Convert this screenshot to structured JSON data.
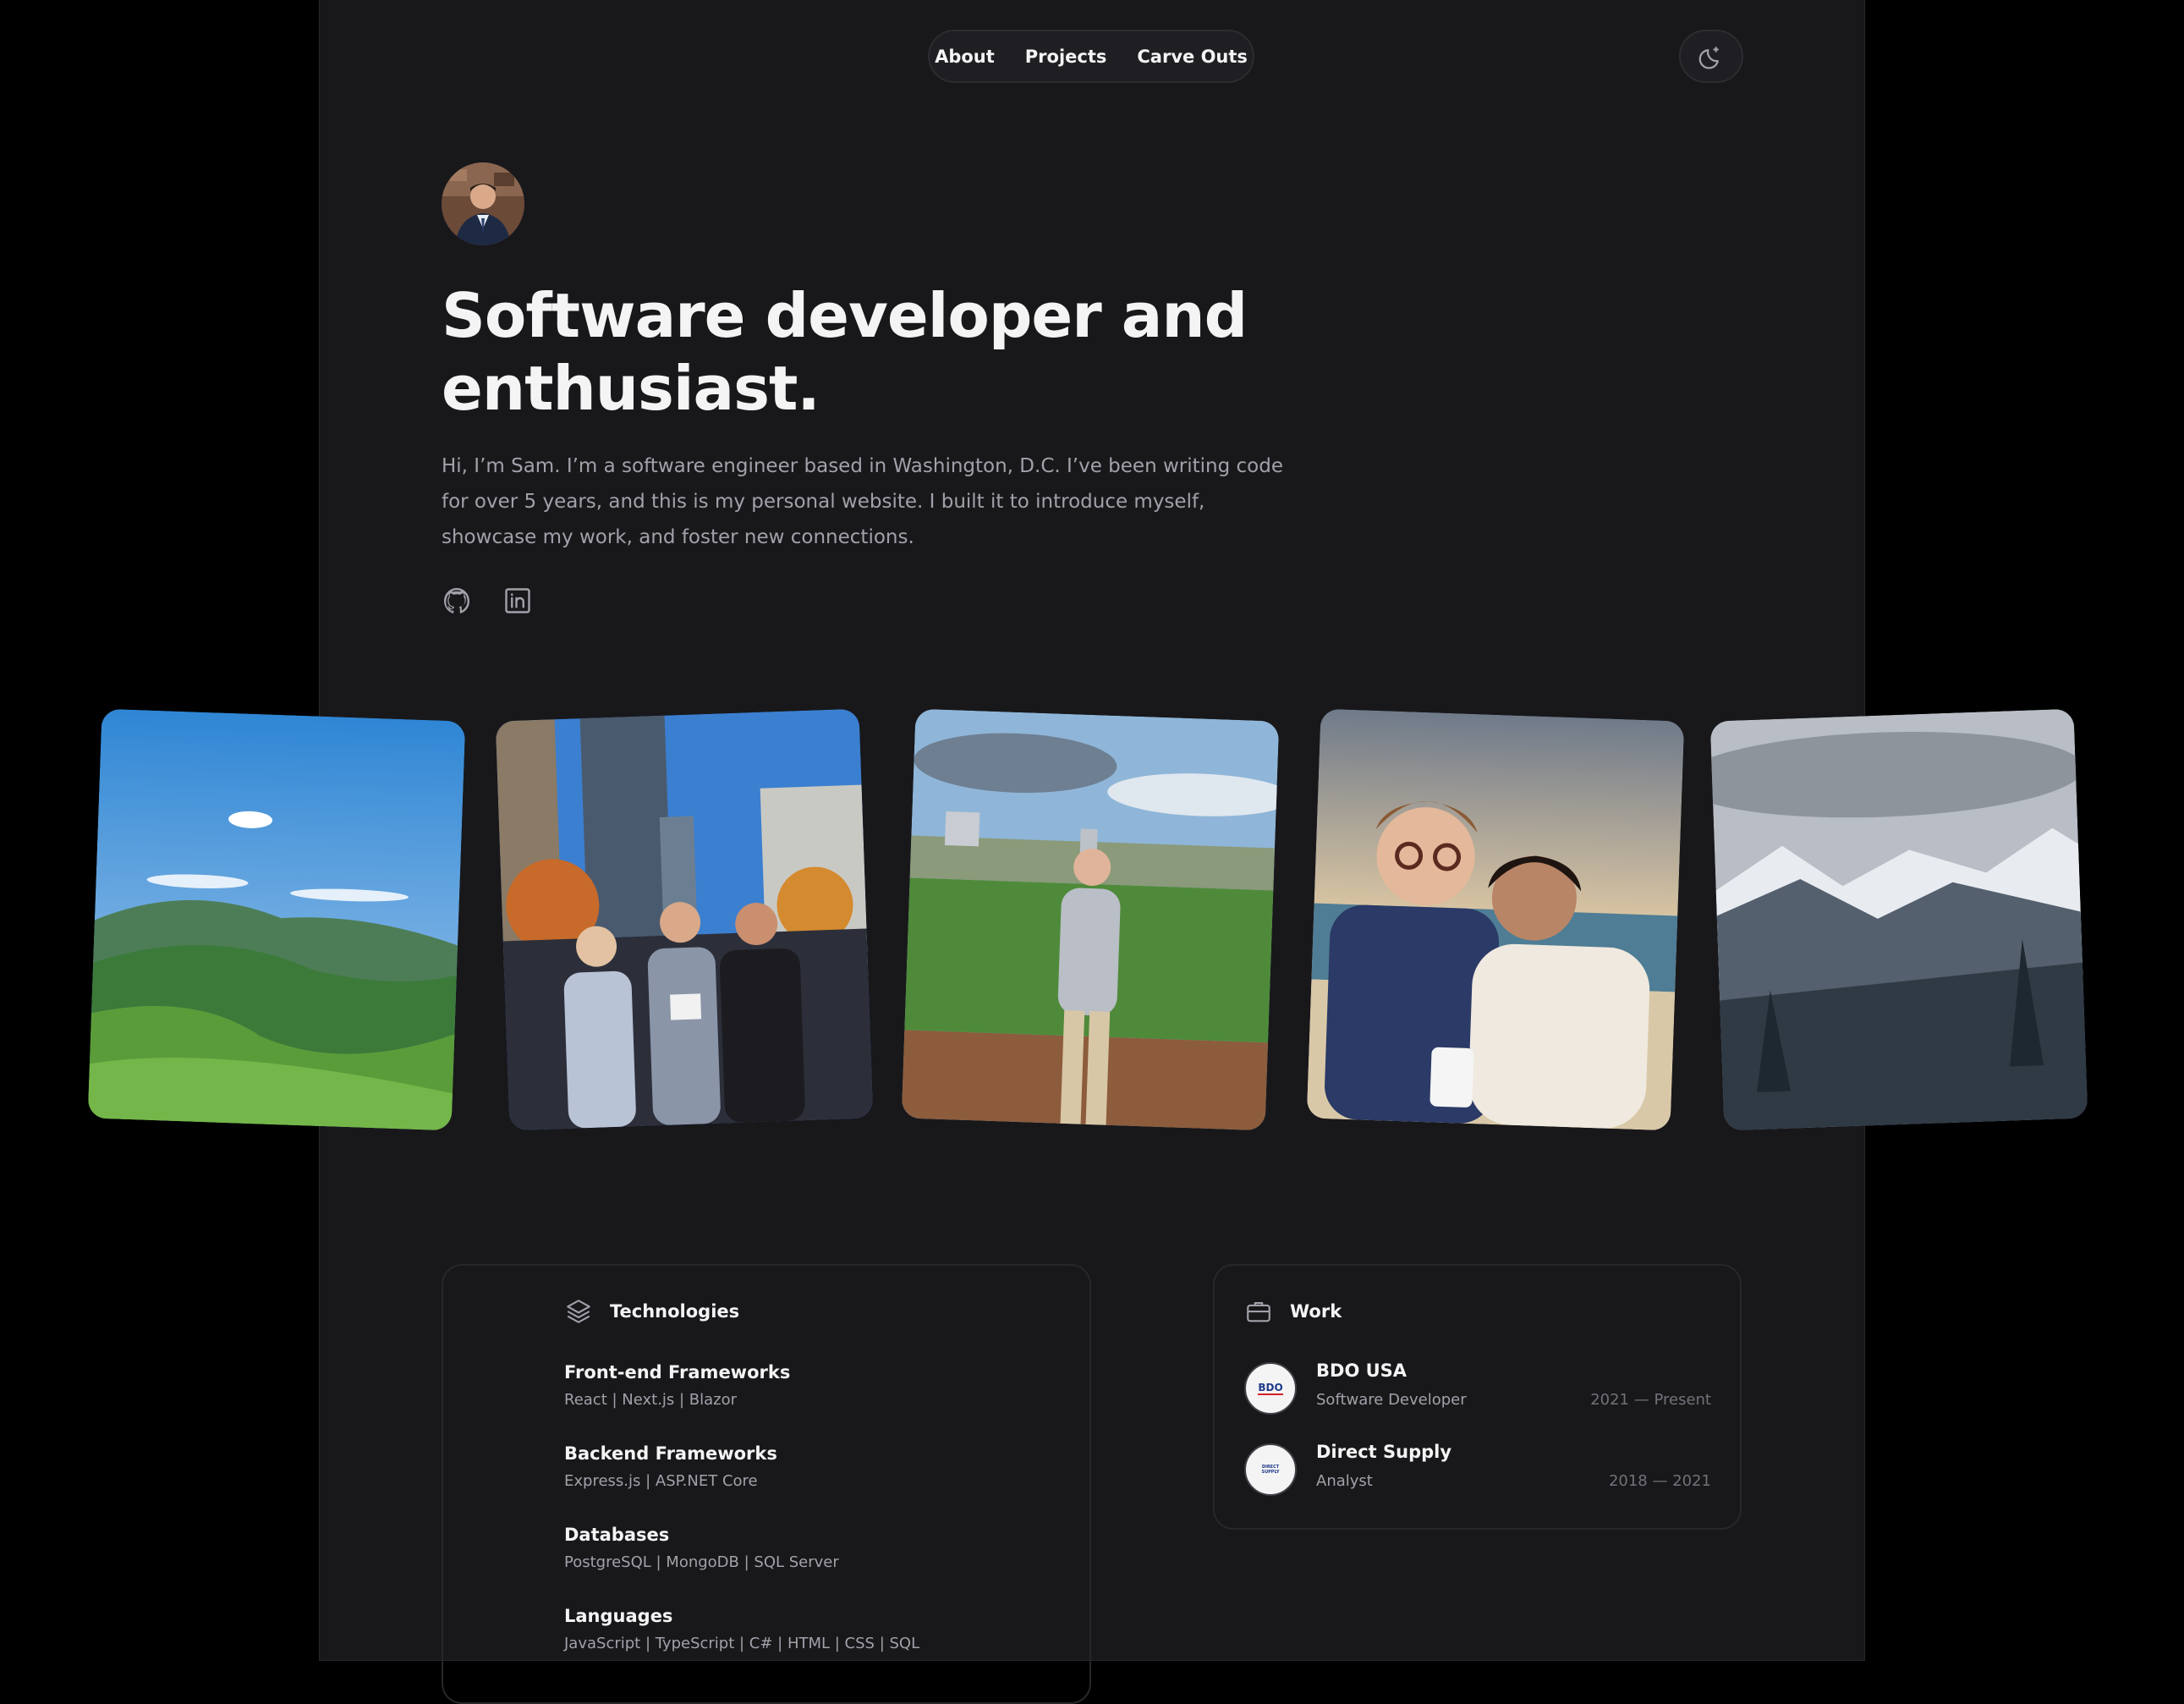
{
  "nav": {
    "items": [
      {
        "label": "About"
      },
      {
        "label": "Projects"
      },
      {
        "label": "Carve Outs"
      }
    ]
  },
  "theme_toggle": {
    "icon": "moon-icon"
  },
  "hero": {
    "headline": "Software developer and enthusiast.",
    "intro": "Hi, I’m Sam. I’m a software engineer based in Washington, D.C. I’ve been writing code for over 5 years, and this is my personal website. I built it to introduce myself, showcase my work, and foster new connections.",
    "social": [
      {
        "icon": "github-icon"
      },
      {
        "icon": "linkedin-icon"
      }
    ]
  },
  "technologies": {
    "title": "Technologies",
    "groups": [
      {
        "name": "Front-end Frameworks",
        "items": "React | Next.js | Blazor"
      },
      {
        "name": "Backend Frameworks",
        "items": "Express.js | ASP.NET Core"
      },
      {
        "name": "Databases",
        "items": "PostgreSQL | MongoDB | SQL Server"
      },
      {
        "name": "Languages",
        "items": "JavaScript | TypeScript | C# | HTML | CSS | SQL"
      }
    ]
  },
  "work": {
    "title": "Work",
    "jobs": [
      {
        "company": "BDO USA",
        "role": "Software Developer",
        "dates": "2021 — Present",
        "logo_text": "BDO"
      },
      {
        "company": "Direct Supply",
        "role": "Analyst",
        "dates": "2018 — 2021",
        "logo_text": "DIRECT SUPPLY"
      }
    ]
  },
  "colors": {
    "page_bg": "#18181b",
    "outer_bg": "#000000",
    "text_primary": "#f4f4f5",
    "text_secondary": "#a1a1aa"
  }
}
